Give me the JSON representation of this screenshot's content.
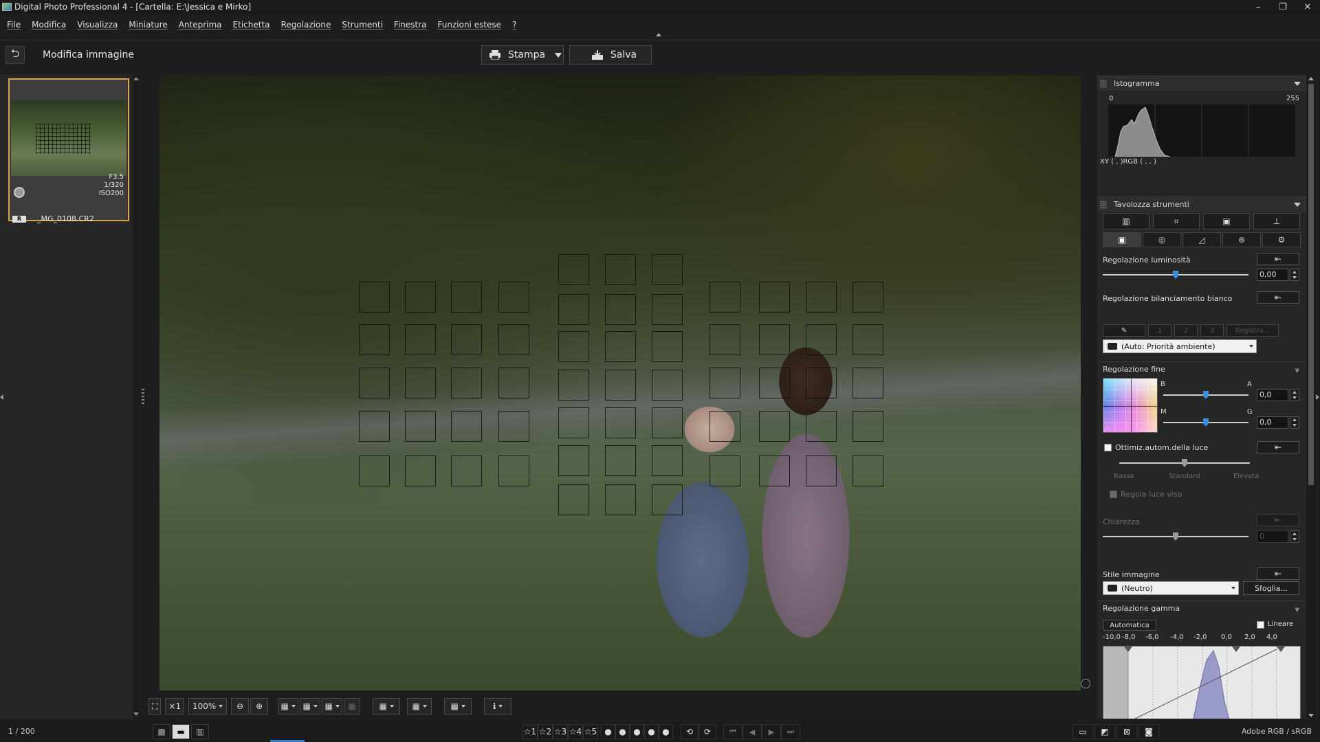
{
  "window": {
    "title": "Digital Photo Professional 4 - [Cartella: E:\\Jessica e Mirko]",
    "min_glyph": "–",
    "restore_glyph": "❐",
    "close_glyph": "✕"
  },
  "menu": [
    {
      "label": "File"
    },
    {
      "label": "Modifica"
    },
    {
      "label": "Visualizza"
    },
    {
      "label": "Miniature"
    },
    {
      "label": "Anteprima"
    },
    {
      "label": "Etichetta"
    },
    {
      "label": "Regolazione"
    },
    {
      "label": "Strumenti"
    },
    {
      "label": "Finestra"
    },
    {
      "label": "Funzioni estese"
    },
    {
      "label": "?"
    }
  ],
  "toolbar": {
    "back_glyph": "⮌",
    "mode_label": "Modifica immagine",
    "print_label": "Stampa",
    "save_label": "Salva"
  },
  "thumbnail": {
    "aperture": "F3.5",
    "shutter": "1/320",
    "iso": "ISO200",
    "badge": "R",
    "filename": "_MG_0108.CR2"
  },
  "bottom_tools": {
    "fit_glyph": "⛶",
    "x1_label": "×1",
    "zoom_value": "100%",
    "zoom_out_glyph": "⊖",
    "zoom_in_glyph": "⊕",
    "af_glyph": "▦",
    "grid_glyph": "▦",
    "info_glyph": "ℹ"
  },
  "status": {
    "count": "1 / 200",
    "ratings": [
      "☆1",
      "☆2",
      "☆3",
      "☆4",
      "☆5"
    ],
    "dots": [
      "●",
      "●",
      "●",
      "●",
      "●"
    ],
    "nav": [
      "⏮",
      "◀",
      "▶",
      "⏭"
    ],
    "colorspace": "Adobe RGB / sRGB"
  },
  "histogram": {
    "title": "Istogramma",
    "min_label": "0",
    "max_label": "255",
    "readout": "XY (   ,   )RGB (   ,   ,   )"
  },
  "tool_palette": {
    "title": "Tavolozza strumenti",
    "brightness_label": "Regolazione luminosità",
    "brightness_value": "0,00",
    "brightness_level": 0.5,
    "wb_label": "Regolazione bilanciamento bianco",
    "wb_buttons": [
      "1",
      "2",
      "3"
    ],
    "wb_register": "Registra...",
    "wb_select": "(Auto: Priorità ambiente)",
    "fine_label": "Regolazione fine",
    "fine_b": "B",
    "fine_a": "A",
    "fine_m": "M",
    "fine_g": "G",
    "fine_ba_value": "0,0",
    "fine_mg_value": "0,0",
    "alo_label": "Ottimiz.autom.della luce",
    "alo_low": "Bassa",
    "alo_std": "Standard",
    "alo_high": "Elevata",
    "face_label": "Regola luce viso",
    "clarity_label": "Chiarezza",
    "clarity_value": "0",
    "style_label": "Stile immagine",
    "style_select": "(Neutro)",
    "browse_label": "Sfoglia...",
    "gamma_label": "Regolazione gamma",
    "gamma_auto": "Automatica",
    "gamma_linear": "Lineare",
    "gamma_ticks": [
      "-10,0",
      "-8,0",
      "-6,0",
      "-4,0",
      "-2,0",
      "0,0",
      "2,0",
      "4,0"
    ]
  },
  "colors": {
    "accent": "#3b8fe0",
    "thumb_border": "#d4a74a",
    "panel_bg": "#262626"
  }
}
